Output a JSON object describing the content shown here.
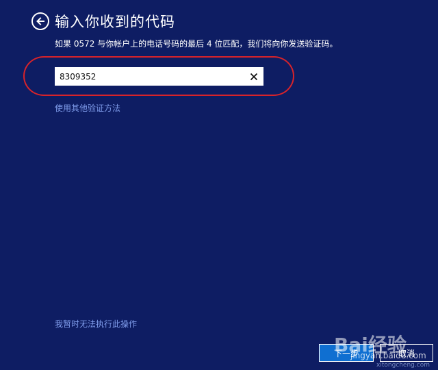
{
  "header": {
    "title": "输入你收到的代码",
    "back_icon": "back-arrow-icon"
  },
  "description": "如果 0572 与你帐户上的电话号码的最后 4 位匹配，我们将向你发送验证码。",
  "code_input": {
    "value": "8309352",
    "clear_icon": "close-icon"
  },
  "links": {
    "alternate_method": "使用其他验证方法",
    "cannot_do_now": "我暂时无法执行此操作"
  },
  "buttons": {
    "next": "下一步",
    "cancel": "取消"
  },
  "watermark": {
    "brand": "Bai经验",
    "url": "jingyan.baidu.com",
    "footer": "xitongcheng.com"
  },
  "colors": {
    "background": "#0e1d63",
    "link": "#7e9bea",
    "highlight_ring": "#d8232a",
    "primary_button": "#0f6fd1"
  }
}
